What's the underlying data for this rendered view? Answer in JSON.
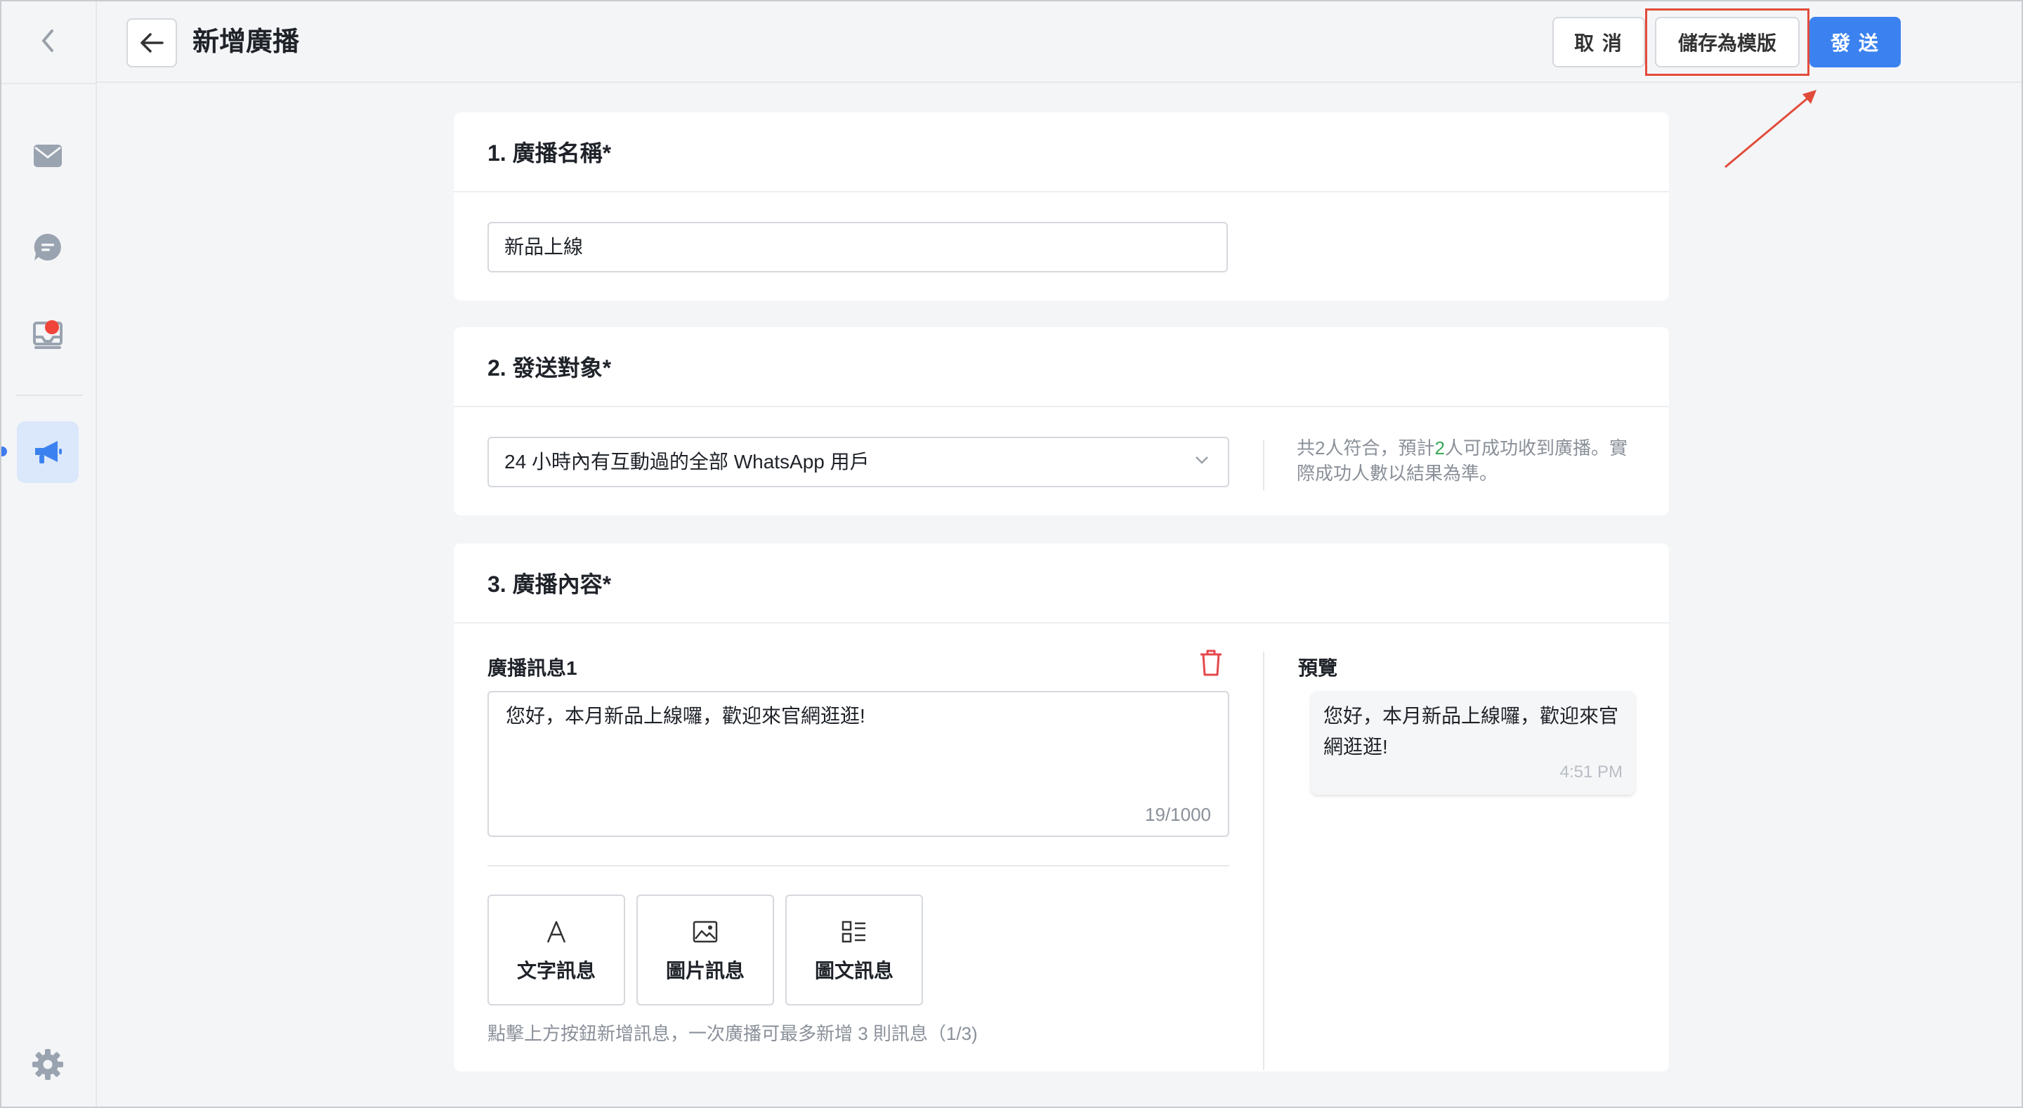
{
  "header": {
    "title": "新增廣播",
    "cancel_label": "取 消",
    "save_template_label": "儲存為模版",
    "send_label": "發 送"
  },
  "sidebar": {
    "items": [
      {
        "icon": "mail-icon"
      },
      {
        "icon": "chat-icon"
      },
      {
        "icon": "inbox-tray-icon",
        "badge": true
      },
      {
        "icon": "megaphone-icon",
        "active": true
      }
    ],
    "settings_icon": "gear-icon"
  },
  "section1": {
    "title": "1. 廣播名稱*",
    "name_value": "新品上線"
  },
  "section2": {
    "title": "2. 發送對象*",
    "selected_audience": "24 小時內有互動過的全部 WhatsApp 用戶",
    "hint_prefix": "共2人符合，預計",
    "hint_count": "2",
    "hint_suffix": "人可成功收到廣播。實際成功人數以結果為準。"
  },
  "section3": {
    "title": "3. 廣播內容*",
    "message_label": "廣播訊息1",
    "message_text": "您好，本月新品上線囉，歡迎來官網逛逛!",
    "char_count": "19/1000",
    "type_buttons": [
      "文字訊息",
      "圖片訊息",
      "圖文訊息"
    ],
    "footnote": "點擊上方按鈕新增訊息，一次廣播可最多新增 3 則訊息（1/3)",
    "preview_label": "預覽",
    "preview_text": "您好，本月新品上線囉，歡迎來官網逛逛!",
    "preview_time": "4:51 PM"
  },
  "colors": {
    "accent": "#3b82f0",
    "highlight": "#e14c3a",
    "danger": "#e5484d",
    "success": "#3aa757"
  }
}
